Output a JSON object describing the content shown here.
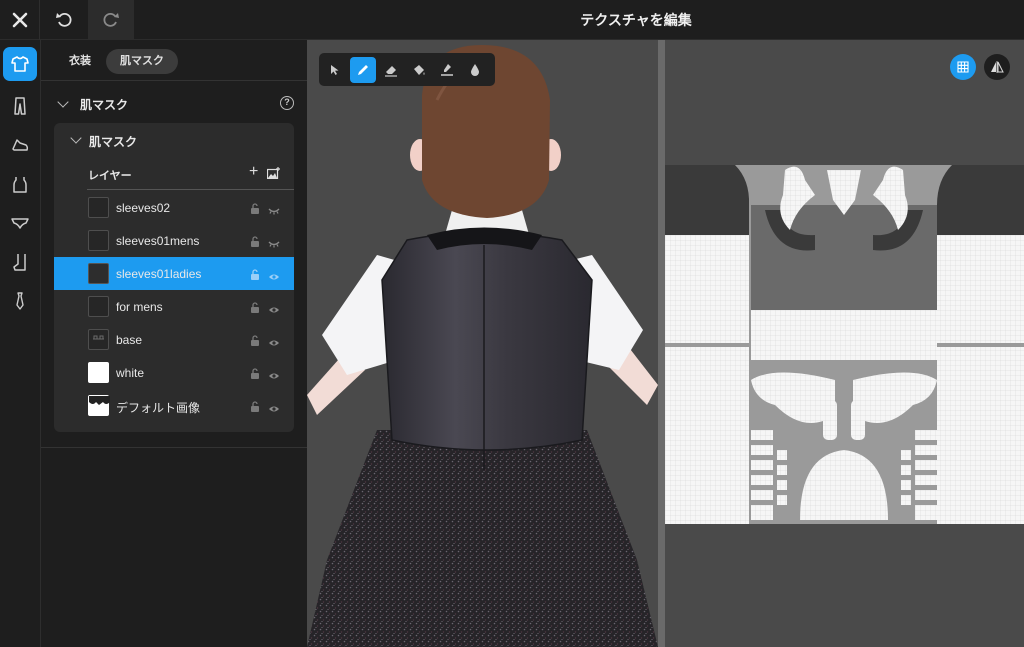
{
  "window": {
    "title": "テクスチャを編集"
  },
  "tabs": [
    {
      "label": "衣装",
      "active": false
    },
    {
      "label": "肌マスク",
      "active": true
    }
  ],
  "section": {
    "title": "肌マスク"
  },
  "group": {
    "title": "肌マスク",
    "layer_header": "レイヤー",
    "layers": [
      {
        "name": "sleeves02",
        "selected": false,
        "visibility": "hidden",
        "thumb": "empty"
      },
      {
        "name": "sleeves01mens",
        "selected": false,
        "visibility": "hidden",
        "thumb": "empty"
      },
      {
        "name": "sleeves01ladies",
        "selected": true,
        "visibility": "visible",
        "thumb": "dark"
      },
      {
        "name": "for mens",
        "selected": false,
        "visibility": "visible",
        "thumb": "empty"
      },
      {
        "name": "base",
        "selected": false,
        "visibility": "visible",
        "thumb": "pattern"
      },
      {
        "name": "white",
        "selected": false,
        "visibility": "visible",
        "thumb": "white"
      },
      {
        "name": "デフォルト画像",
        "selected": false,
        "visibility": "visible",
        "thumb": "default"
      }
    ]
  },
  "rail": {
    "items": [
      "shirt-icon",
      "pants-icon",
      "shoe-icon",
      "top-icon",
      "underwear-icon",
      "sock-icon",
      "tie-icon"
    ],
    "active_index": 0
  },
  "toolbar": {
    "tools": [
      "select-tool-icon",
      "pen-tool-icon",
      "eraser-tool-icon",
      "fill-tool-icon",
      "stamp-tool-icon",
      "blur-tool-icon"
    ],
    "active_index": 1
  },
  "colors": {
    "accent": "#1d9bf0",
    "background": "#1e1e1e",
    "viewport": "#4a4a4a",
    "hair": "#6e4631",
    "vest": "#35333b"
  }
}
